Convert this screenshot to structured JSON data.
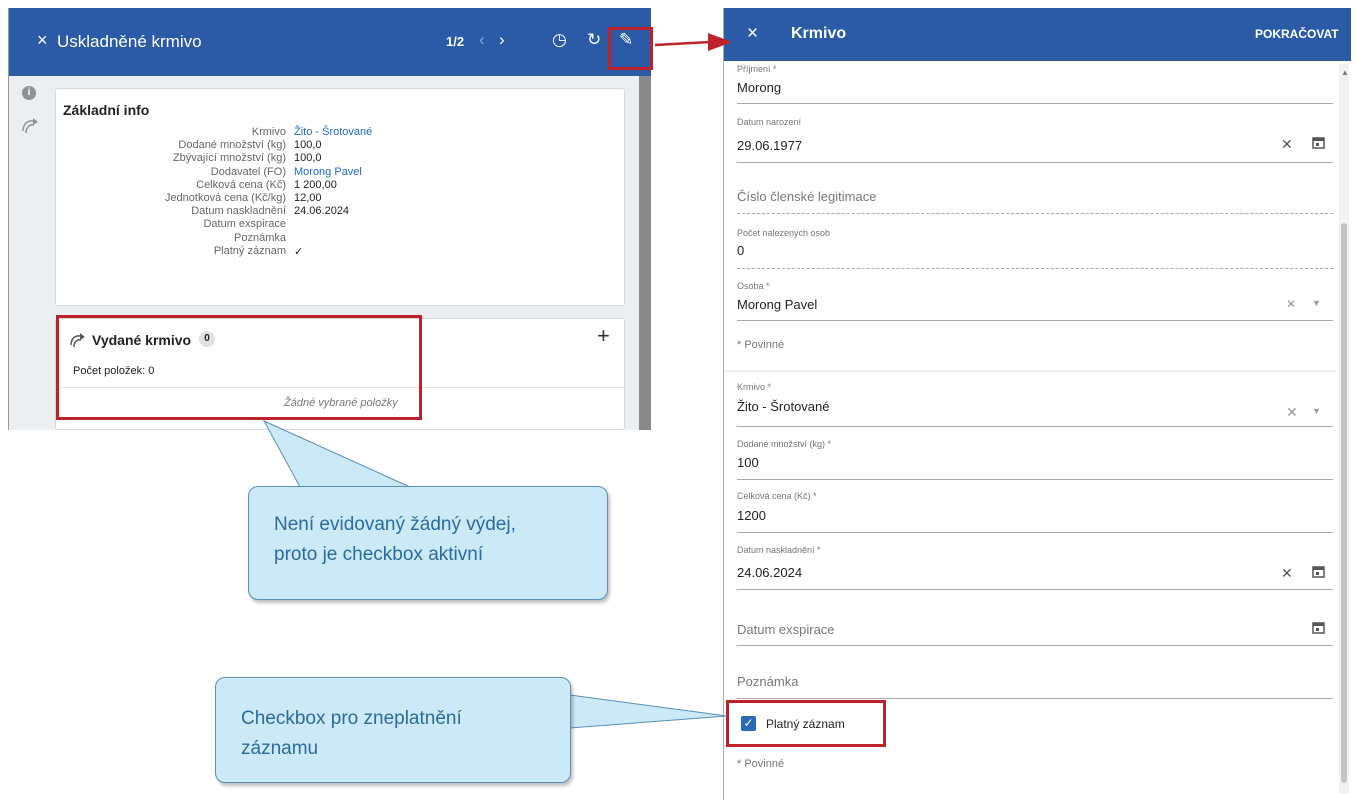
{
  "left_panel": {
    "title": "Uskladněné krmivo",
    "pager": "1/2",
    "prev_icon": "‹",
    "next_icon": "›",
    "close_icon": "×",
    "history_icon": "◷",
    "refresh_icon": "↻",
    "edit_icon": "✎",
    "basic_info": {
      "heading": "Základní info",
      "rows": [
        {
          "label": "Krmivo",
          "value": "Žito - Šrotované",
          "link": true
        },
        {
          "label": "Dodané množství (kg)",
          "value": "100,0"
        },
        {
          "label": "Zbývající množství (kg)",
          "value": "100,0"
        },
        {
          "label": "Dodavatel (FO)",
          "value": "Morong Pavel",
          "link": true
        },
        {
          "label": "Celková cena (Kč)",
          "value": "1 200,00"
        },
        {
          "label": "Jednotková cena (Kč/kg)",
          "value": "12,00"
        },
        {
          "label": "Datum naskladnění",
          "value": "24.06.2024"
        },
        {
          "label": "Datum exspirace",
          "value": ""
        },
        {
          "label": "Poznámka",
          "value": ""
        },
        {
          "label": "Platný záznam",
          "value": "✓"
        }
      ]
    },
    "issued": {
      "heading": "Vydané krmivo",
      "count": "0",
      "add_icon": "+",
      "items_count": "Počet položek: 0",
      "empty_text": "Žádné vybrané položky"
    }
  },
  "right_panel": {
    "title": "Krmivo",
    "close_icon": "×",
    "continue_label": "POKRAČOVAT",
    "fields": {
      "surname": {
        "label": "Příjmení *",
        "value": "Morong"
      },
      "birth_date": {
        "label": "Datum narození",
        "value": "29.06.1977"
      },
      "member_card": {
        "placeholder": "Číslo členské legitimace"
      },
      "found_persons": {
        "label": "Počet nalezených osob",
        "value": "0"
      },
      "person": {
        "label": "Osoba *",
        "value": "Morong Pavel"
      },
      "required_note_1": "* Povinné",
      "feed": {
        "label": "Krmivo *",
        "value": "Žito - Šrotované"
      },
      "delivered_qty": {
        "label": "Dodané množství (kg) *",
        "value": "100"
      },
      "total_price": {
        "label": "Celková cena (Kč) *",
        "value": "1200"
      },
      "storage_date": {
        "label": "Datum naskladnění *",
        "value": "24.06.2024"
      },
      "expiry": {
        "placeholder": "Datum exspirace"
      },
      "note": {
        "placeholder": "Poznámka"
      },
      "valid": {
        "label": "Platný záznam",
        "checked": true
      },
      "required_note_2": "* Povinné"
    }
  },
  "callouts": {
    "top_line1": "Není evidovaný žádný výdej,",
    "top_line2": "proto je checkbox aktivní",
    "bottom_line1": "Checkbox pro zneplatnění",
    "bottom_line2": "záznamu"
  },
  "colors": {
    "header_blue": "#2b5aa6",
    "link_blue": "#1e6bc8",
    "highlight_red": "#c0222a",
    "callout_fill": "#cbe9f7"
  }
}
